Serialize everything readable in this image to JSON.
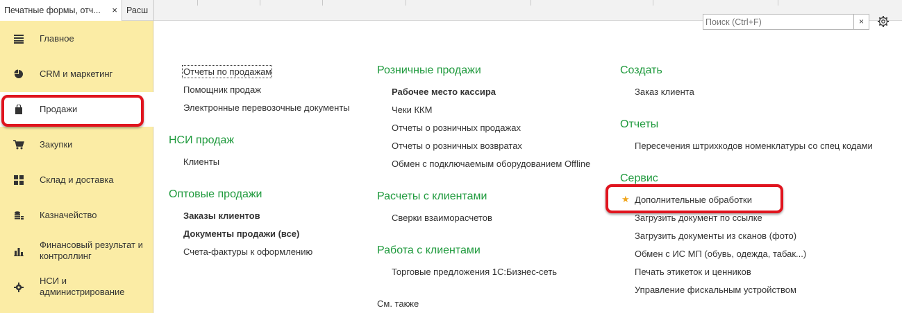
{
  "tabs": [
    {
      "label": "Печатные формы, отч...",
      "close": "×"
    },
    {
      "label": "Расш"
    }
  ],
  "sidebar": {
    "items": [
      {
        "label": "Главное",
        "icon": "menu-lines-icon"
      },
      {
        "label": "CRM и маркетинг",
        "icon": "pie-chart-icon"
      },
      {
        "label": "Продажи",
        "icon": "shopping-bag-icon"
      },
      {
        "label": "Закупки",
        "icon": "cart-icon"
      },
      {
        "label": "Склад и доставка",
        "icon": "grid-icon"
      },
      {
        "label": "Казначейство",
        "icon": "coins-icon"
      },
      {
        "label": "Финансовый результат и",
        "label2": "контроллинг",
        "icon": "bar-chart-icon"
      },
      {
        "label": "НСИ и",
        "label2": "администрирование",
        "icon": "gear-icon"
      }
    ]
  },
  "search": {
    "placeholder": "Поиск (Ctrl+F)",
    "clear": "×"
  },
  "col1": {
    "items": [
      "Отчеты по продажам",
      "Помощник продаж",
      "Электронные перевозочные документы"
    ],
    "nsi": {
      "title": "НСИ продаж",
      "items": [
        "Клиенты"
      ]
    },
    "wholesale": {
      "title": "Оптовые продажи",
      "items": [
        "Заказы клиентов",
        "Документы продажи (все)",
        "Счета-фактуры к оформлению"
      ]
    }
  },
  "col2": {
    "retail": {
      "title": "Розничные продажи",
      "items": [
        "Рабочее место кассира",
        "Чеки ККМ",
        "Отчеты о розничных продажах",
        "Отчеты о розничных возвратах",
        "Обмен с подключаемым оборудованием Offline"
      ]
    },
    "settlements": {
      "title": "Расчеты с клиентами",
      "items": [
        "Сверки взаиморасчетов"
      ]
    },
    "clients": {
      "title": "Работа с клиентами",
      "items": [
        "Торговые предложения 1С:Бизнес-сеть"
      ]
    },
    "see_also": "См. также"
  },
  "col3": {
    "create": {
      "title": "Создать",
      "items": [
        "Заказ клиента"
      ]
    },
    "reports": {
      "title": "Отчеты",
      "items": [
        "Пересечения штрихкодов номенклатуры со спец кодами"
      ]
    },
    "service": {
      "title": "Сервис",
      "items": [
        "Дополнительные обработки",
        "Загрузить документ по ссылке",
        "Загрузить документы из сканов (фото)",
        "Обмен с ИС МП (обувь, одежда, табак...)",
        "Печать этикеток и ценников",
        "Управление фискальным устройством"
      ]
    }
  },
  "colors": {
    "sidebar_bg": "#fbeca5",
    "section_green": "#1f9a3d",
    "highlight_red": "#e0141e",
    "star": "#f0a51b"
  }
}
